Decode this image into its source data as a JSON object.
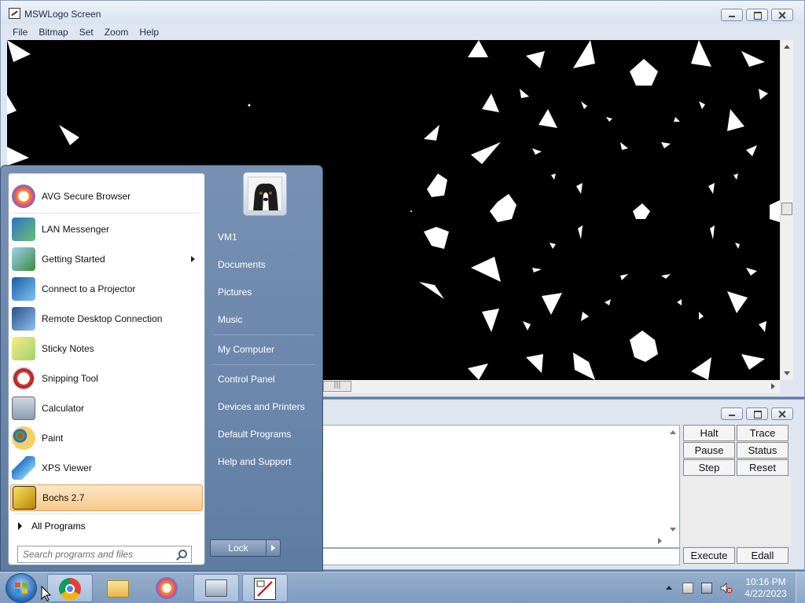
{
  "logo_window": {
    "title": "MSWLogo Screen",
    "menu": [
      "File",
      "Bitmap",
      "Set",
      "Zoom",
      "Help"
    ]
  },
  "commander": {
    "buttons": [
      "Halt",
      "Trace",
      "Pause",
      "Status",
      "Step",
      "Reset"
    ],
    "execute_label": "Execute",
    "edall_label": "Edall"
  },
  "start_menu": {
    "programs": [
      {
        "label": "AVG Secure Browser",
        "icon": "avg-browser-icon"
      },
      {
        "label": "LAN Messenger",
        "icon": "lan-messenger-icon"
      },
      {
        "label": "Getting Started",
        "icon": "getting-started-icon"
      },
      {
        "label": "Connect to a Projector",
        "icon": "projector-icon"
      },
      {
        "label": "Remote Desktop Connection",
        "icon": "remote-desktop-icon"
      },
      {
        "label": "Sticky Notes",
        "icon": "sticky-notes-icon"
      },
      {
        "label": "Snipping Tool",
        "icon": "snipping-tool-icon"
      },
      {
        "label": "Calculator",
        "icon": "calculator-icon"
      },
      {
        "label": "Paint",
        "icon": "paint-icon"
      },
      {
        "label": "XPS Viewer",
        "icon": "xps-viewer-icon"
      },
      {
        "label": "Bochs 2.7",
        "icon": "bochs-icon"
      }
    ],
    "all_programs": "All Programs",
    "search_placeholder": "Search programs and files",
    "right_items": [
      "VM1",
      "Documents",
      "Pictures",
      "Music",
      "My Computer",
      "Control Panel",
      "Devices and Printers",
      "Default Programs",
      "Help and Support"
    ],
    "lock_label": "Lock"
  },
  "taskbar": {
    "apps": [
      "chrome-icon",
      "file-explorer-icon",
      "avg-browser-icon",
      "keyboard-app-icon",
      "mswlogo-icon"
    ],
    "clock_time": "10:16 PM",
    "clock_date": "4/22/2023"
  },
  "colors": {
    "accent": "#6b86ab",
    "selection": "#f9c98c",
    "canvas": "#000000"
  }
}
